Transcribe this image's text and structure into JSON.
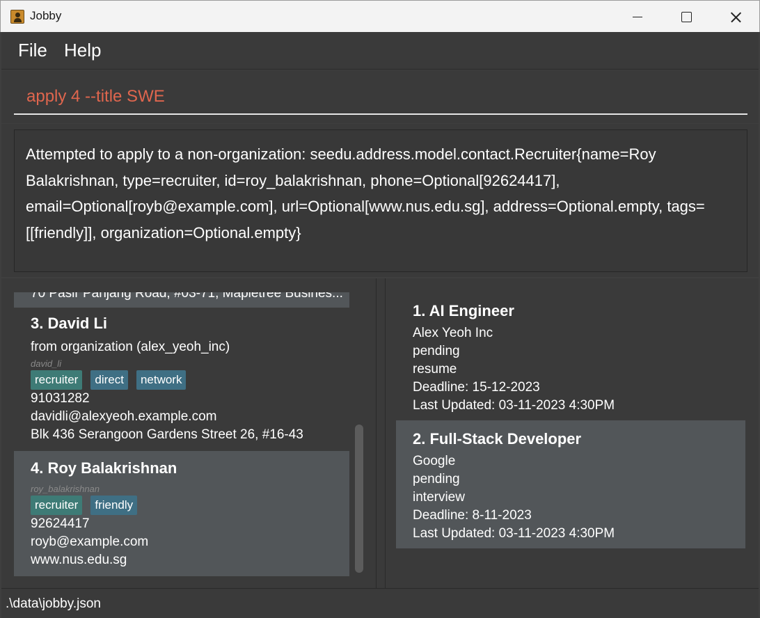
{
  "window": {
    "title": "Jobby"
  },
  "menu": {
    "file": "File",
    "help": "Help"
  },
  "command": {
    "value": "apply 4 --title SWE"
  },
  "result": {
    "text": "Attempted to apply to a non-organization: seedu.address.model.contact.Recruiter{name=Roy Balakrishnan, type=recruiter, id=roy_balakrishnan, phone=Optional[92624417], email=Optional[royb@example.com], url=Optional[www.nus.edu.sg], address=Optional.empty, tags=[[friendly]], organization=Optional.empty}"
  },
  "contacts": {
    "peek": "70 Pasir Panjang Road, #03-71, Mapletree Busines...",
    "items": [
      {
        "title": "3.  David Li",
        "from_org": "from organization (alex_yeoh_inc)",
        "id": "david_li",
        "tags": [
          "recruiter",
          "direct",
          "network"
        ],
        "phone": "91031282",
        "email": "davidli@alexyeoh.example.com",
        "address": "Blk 436 Serangoon Gardens Street 26, #16-43"
      },
      {
        "title": "4.  Roy Balakrishnan",
        "id": "roy_balakrishnan",
        "tags": [
          "recruiter",
          "friendly"
        ],
        "phone": "92624417",
        "email": "royb@example.com",
        "url": "www.nus.edu.sg"
      }
    ]
  },
  "applications": [
    {
      "title": "1.  AI Engineer",
      "company": "Alex Yeoh Inc",
      "status": "pending",
      "stage": "resume",
      "deadline": "Deadline: 15-12-2023",
      "updated": "Last Updated: 03-11-2023 4:30PM"
    },
    {
      "title": "2.  Full-Stack Developer",
      "company": "Google",
      "status": "pending",
      "stage": "interview",
      "deadline": "Deadline: 8-11-2023",
      "updated": "Last Updated: 03-11-2023 4:30PM"
    }
  ],
  "status_bar": {
    "path": ".\\data\\jobby.json"
  },
  "colors": {
    "background": "#3a3a3a",
    "selected_card": "#525659",
    "command_text": "#e0664e",
    "tag_green": "#3e7b76",
    "tag_blue": "#3f6f84"
  }
}
